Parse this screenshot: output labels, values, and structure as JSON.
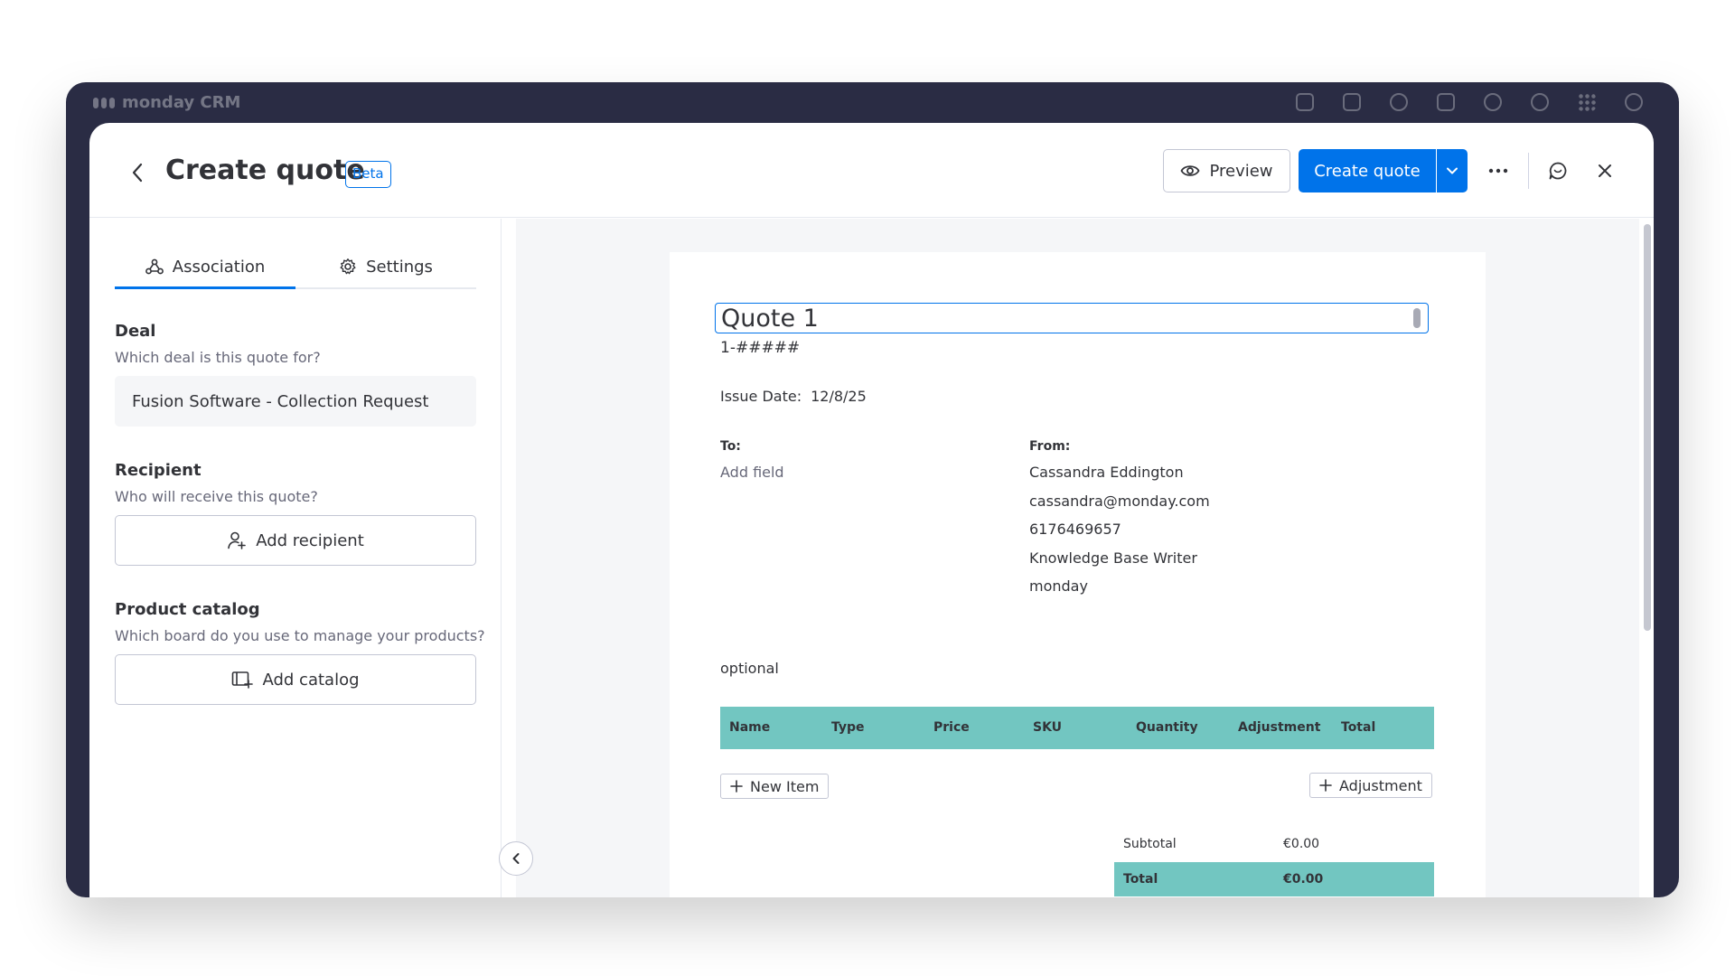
{
  "app": {
    "brand": "monday CRM"
  },
  "modal": {
    "title": "Create quote",
    "badge": "Beta",
    "preview_label": "Preview",
    "create_label": "Create quote"
  },
  "tabs": [
    {
      "label": "Association",
      "icon": "association-icon",
      "active": true
    },
    {
      "label": "Settings",
      "icon": "gear-icon",
      "active": false
    }
  ],
  "deal": {
    "label": "Deal",
    "sublabel": "Which deal is this quote for?",
    "value": "Fusion Software - Collection Request"
  },
  "recipient": {
    "label": "Recipient",
    "sublabel": "Who will receive this quote?",
    "button_label": "Add recipient"
  },
  "catalog": {
    "label": "Product catalog",
    "sublabel": "Which board do you use to manage your products?",
    "button_label": "Add catalog"
  },
  "quote": {
    "title": "Quote 1",
    "number": "1-#####",
    "issue_date_label": "Issue Date:",
    "issue_date": "12/8/25",
    "to_label": "To:",
    "to_placeholder": "Add field",
    "from_label": "From:",
    "from_lines": [
      "Cassandra Eddington",
      "cassandra@monday.com",
      "6176469657",
      "Knowledge Base Writer",
      "monday"
    ],
    "optional_text": "optional",
    "columns": [
      "Name",
      "Type",
      "Price",
      "SKU",
      "Quantity",
      "Adjustment",
      "Total"
    ],
    "new_item_label": "New Item",
    "adjustment_label": "Adjustment",
    "subtotal_label": "Subtotal",
    "subtotal_value": "€0.00",
    "total_label": "Total",
    "total_value": "€0.00"
  },
  "colors": {
    "accent": "#0073ea",
    "table_header": "#72c6c1",
    "frame": "#2a2c44"
  }
}
